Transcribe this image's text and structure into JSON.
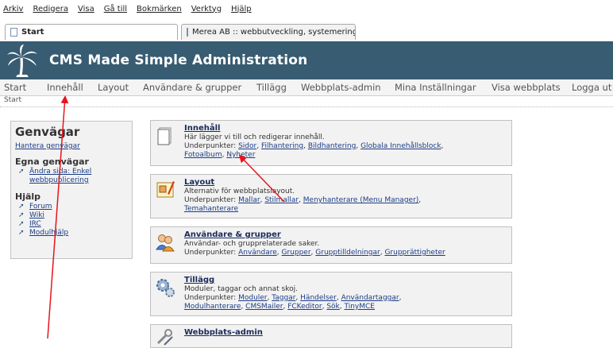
{
  "browser": {
    "menu": [
      "Arkiv",
      "Redigera",
      "Visa",
      "Gå till",
      "Bokmärken",
      "Verktyg",
      "Hjälp"
    ],
    "tabs": [
      {
        "label": "Start",
        "active": true
      },
      {
        "label": "Merea AB :: webbutveckling, systemering s...",
        "active": false
      }
    ]
  },
  "header": {
    "title": "CMS Made Simple Administration",
    "bg_color": "#385c72"
  },
  "nav": [
    "Start",
    "Innehåll",
    "Layout",
    "Användare & grupper",
    "Tillägg",
    "Webbplats-admin",
    "Mina Inställningar",
    "Visa webbplats",
    "Logga ut"
  ],
  "breadcrumb": "Start",
  "shortcuts": {
    "title": "Genvägar",
    "manage": "Hantera genvägar",
    "own_heading": "Egna genvägar",
    "own_items": [
      "Ändra sida: Enkel webbpublicering"
    ],
    "help_heading": "Hjälp",
    "help_items": [
      "Forum",
      "Wiki",
      "IRC",
      "Modulhjälp"
    ]
  },
  "panels": [
    {
      "title": "Innehåll",
      "desc": "Här lägger vi till och redigerar innehåll.",
      "sub_label": "Underpunkter: ",
      "links": [
        "Sidor",
        "Filhantering",
        "Bildhantering",
        "Globala Innehållsblock",
        "Fotoalbum",
        "Nyheter"
      ],
      "icon": "content-page-icon"
    },
    {
      "title": "Layout",
      "desc": "Alternativ för webbplatslayout.",
      "sub_label": "Underpunkter: ",
      "links": [
        "Mallar",
        "Stilmallar",
        "Menyhanterare (Menu Manager)",
        "Temahanterare"
      ],
      "icon": "layout-icon"
    },
    {
      "title": "Användare & grupper",
      "desc": "Användar- och grupprelaterade saker.",
      "sub_label": "Underpunkter: ",
      "links": [
        "Användare",
        "Grupper",
        "Grupptilldelningar",
        "Grupprättigheter"
      ],
      "icon": "users-icon"
    },
    {
      "title": "Tillägg",
      "desc": "Moduler, taggar och annat skoj.",
      "sub_label": "Underpunkter: ",
      "links": [
        "Moduler",
        "Taggar",
        "Händelser",
        "Användartaggar",
        "Modulhanterare",
        "CMSMailer",
        "FCKeditor",
        "Sök",
        "TinyMCE"
      ],
      "icon": "gears-icon"
    },
    {
      "title": "Webbplats-admin",
      "desc": "",
      "sub_label": "",
      "links": [],
      "icon": "tools-icon"
    }
  ]
}
